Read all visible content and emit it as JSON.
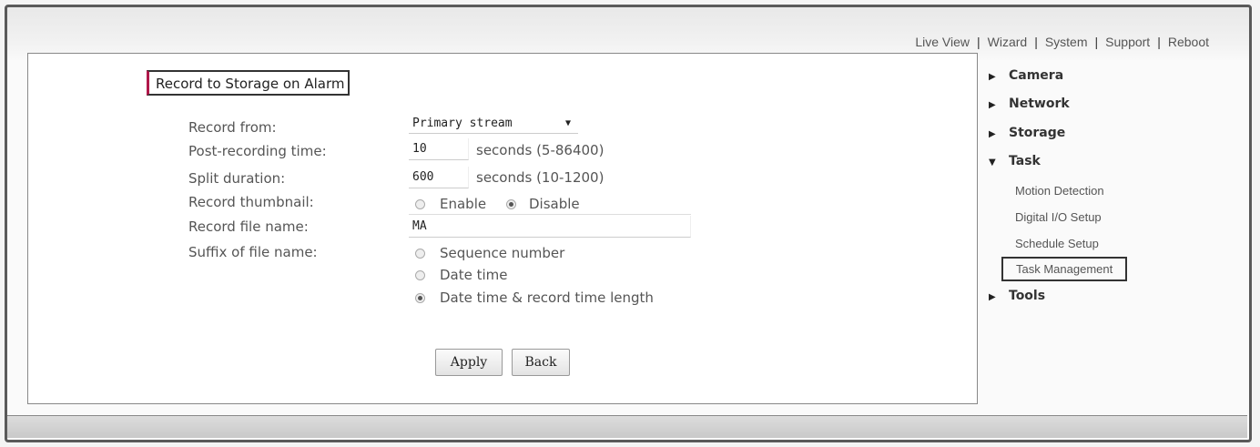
{
  "topnav": {
    "items": [
      "Live View",
      "Wizard",
      "System",
      "Support",
      "Reboot"
    ],
    "separator": "|"
  },
  "form": {
    "title": "Record to Storage on Alarm",
    "labels": {
      "record_from": "Record from:",
      "post_recording": "Post-recording time:",
      "split_duration": "Split duration:",
      "record_thumbnail": "Record thumbnail:",
      "record_file_name": "Record file name:",
      "suffix": "Suffix of file name:"
    },
    "record_from_value": "Primary stream",
    "post_recording_value": "10",
    "post_recording_unit": "seconds (5-86400)",
    "split_duration_value": "600",
    "split_duration_unit": "seconds (10-1200)",
    "thumbnail_options": [
      "Enable",
      "Disable"
    ],
    "thumbnail_selected": "Disable",
    "record_file_name_value": "MA",
    "suffix_options": [
      "Sequence number",
      "Date time",
      "Date time & record time length"
    ],
    "suffix_selected": "Date time & record time length",
    "apply_label": "Apply",
    "back_label": "Back"
  },
  "sidebar": {
    "sections": [
      "Camera",
      "Network",
      "Storage",
      "Task",
      "Tools"
    ],
    "task_items": [
      "Motion Detection",
      "Digital I/O Setup",
      "Schedule Setup",
      "Task Management"
    ],
    "active_item": "Task Management"
  }
}
